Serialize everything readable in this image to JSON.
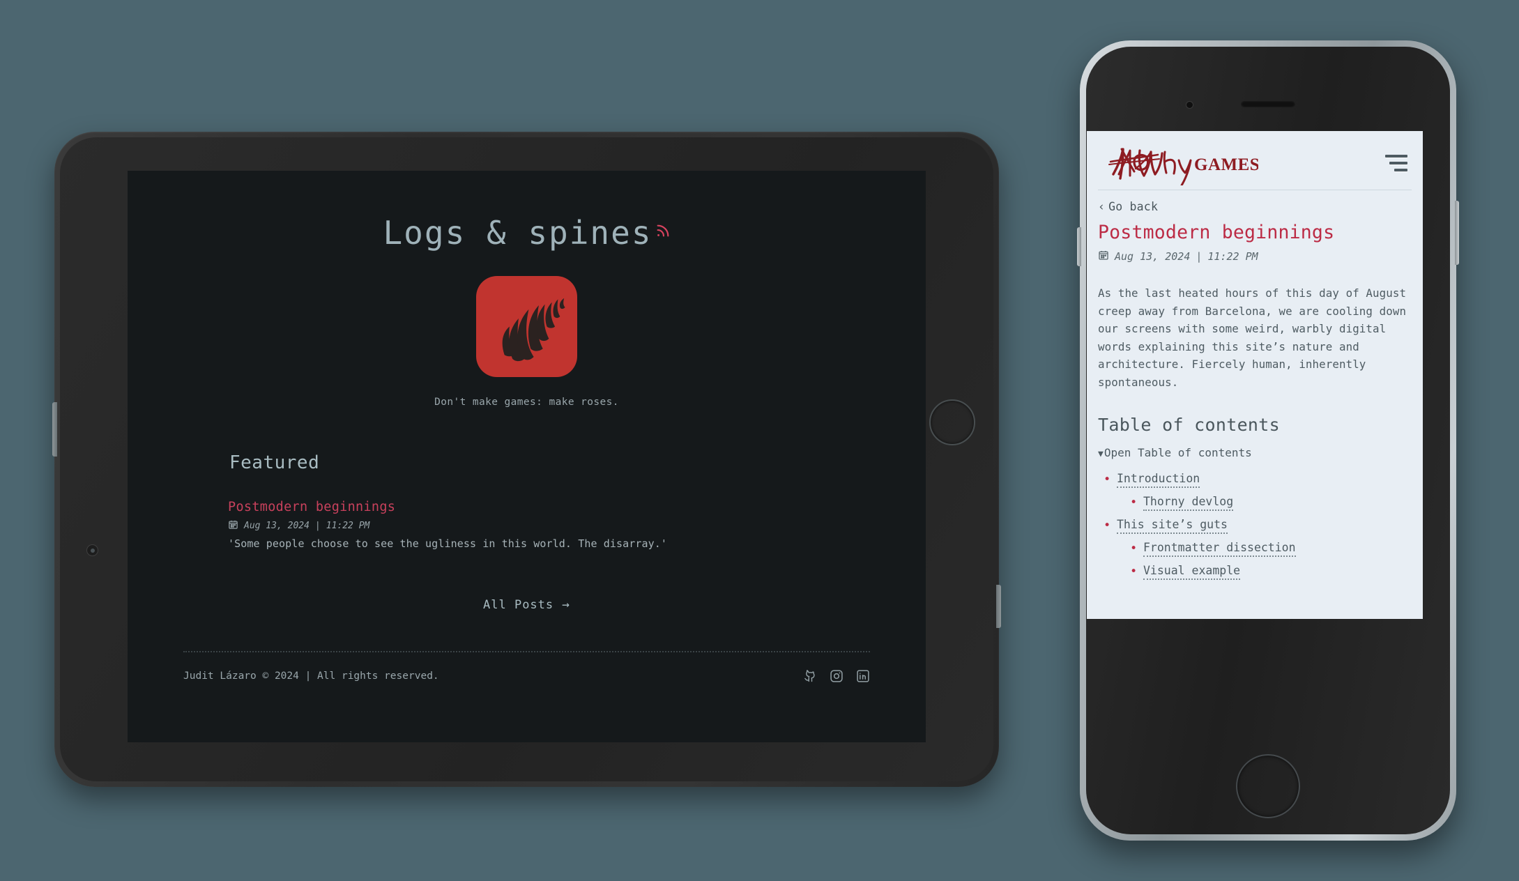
{
  "theme": {
    "backdrop": "#4c6670",
    "tablet_screen_bg": "#15191b",
    "phone_screen_bg": "#e8eef4",
    "accent_red": "#c1342f",
    "link_red": "#c8415c",
    "phone_accent_red": "#bc2b45",
    "muted_text": "#9aa7ac"
  },
  "tablet": {
    "site_title": "Logs & spines",
    "rss_icon": "rss-icon",
    "logo": {
      "name": "thorn-leaf-logo",
      "bg": "#c1342f"
    },
    "tagline": "Don't make games: make roses.",
    "featured_heading": "Featured",
    "featured_post": {
      "title": "Postmodern beginnings",
      "calendar_icon": "calendar-icon",
      "date": "Aug 13, 2024",
      "separator": "|",
      "time": "11:22 PM",
      "snippet": "'Some people choose to see the ugliness in this world. The disarray.'"
    },
    "all_posts_label": "All Posts",
    "all_posts_arrow": "→",
    "footer": {
      "copyright": "Judit Lázaro © 2024 | All rights reserved.",
      "socials": [
        {
          "name": "github-icon",
          "label": "GitHub"
        },
        {
          "name": "instagram-icon",
          "label": "Instagram"
        },
        {
          "name": "linkedin-icon",
          "label": "LinkedIn"
        }
      ]
    }
  },
  "phone": {
    "logo": {
      "name": "nowhy-games-logo",
      "struck_word": "NO",
      "handwritten_word": "Why",
      "small_caps_word": "GAMES"
    },
    "menu_icon": "hamburger-menu-icon",
    "go_back_label": "Go back",
    "go_back_chevron": "‹",
    "post_title": "Postmodern beginnings",
    "calendar_icon": "calendar-icon",
    "date": "Aug 13, 2024",
    "separator": "|",
    "time": "11:22 PM",
    "paragraph": "As the last heated hours of this day of August creep away from Barcelona, we are cooling down our screens with some weird, warbly digital words explaining this site’s nature and architecture. Fiercely human, inherently spontaneous.",
    "toc_heading": "Table of contents",
    "toc_toggle_label": "Open Table of contents",
    "toc_toggle_marker": "▼",
    "toc_items": [
      {
        "label": "Introduction",
        "level": 1
      },
      {
        "label": "Thorny devlog",
        "level": 2
      },
      {
        "label": "This site’s guts",
        "level": 1
      },
      {
        "label": "Frontmatter dissection",
        "level": 2
      },
      {
        "label": "Visual example",
        "level": 2
      }
    ]
  }
}
